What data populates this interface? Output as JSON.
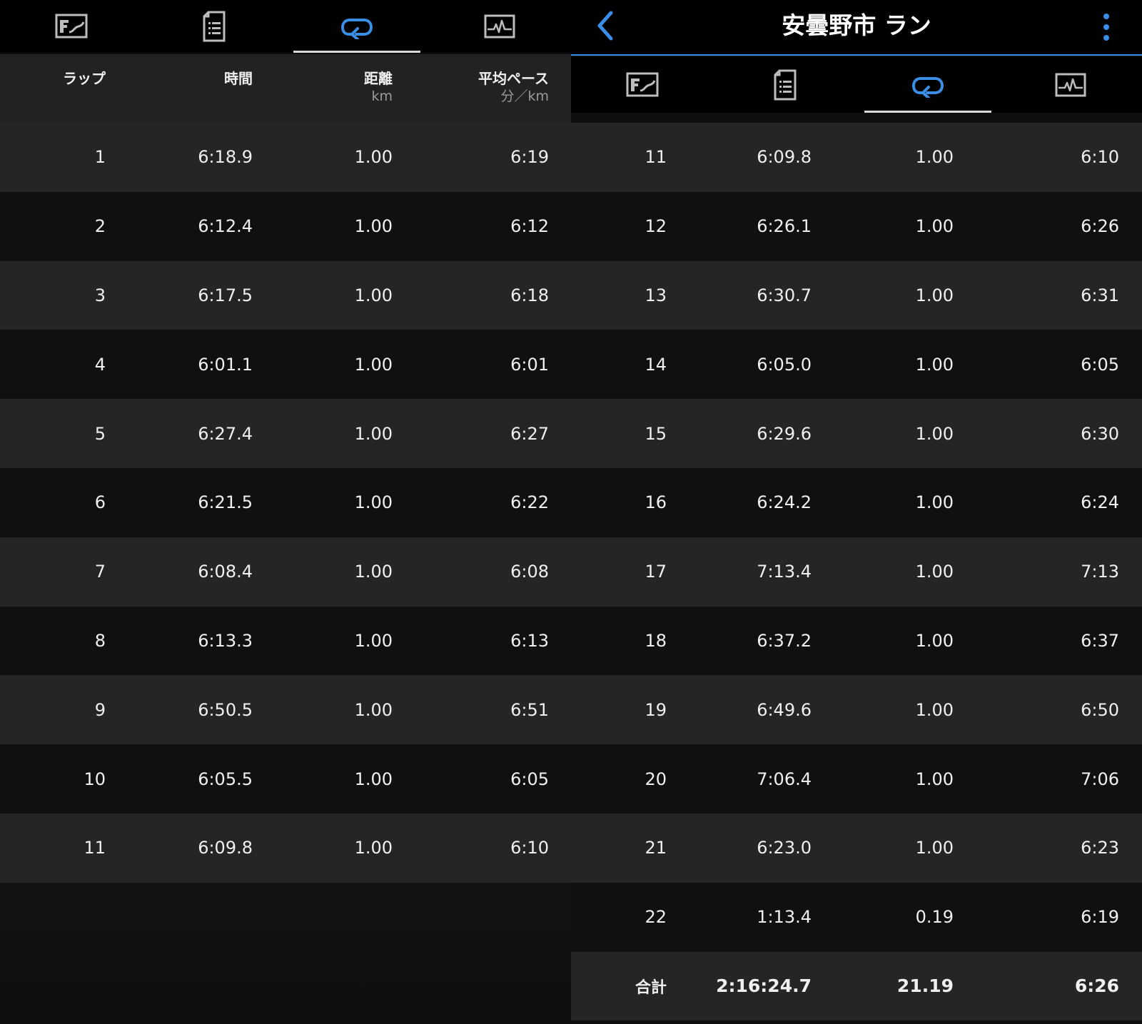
{
  "left_panel": {
    "tabs": [
      {
        "name": "tab-map",
        "icon": "map-icon"
      },
      {
        "name": "tab-details",
        "icon": "document-icon"
      },
      {
        "name": "tab-laps",
        "icon": "laps-loop-icon",
        "active": true
      },
      {
        "name": "tab-charts",
        "icon": "chart-icon"
      }
    ],
    "columns": {
      "lap": {
        "label": "ラップ",
        "unit": ""
      },
      "time": {
        "label": "時間",
        "unit": ""
      },
      "distance": {
        "label": "距離",
        "unit": "km"
      },
      "pace": {
        "label": "平均ペース",
        "unit": "分／km"
      }
    },
    "rows": [
      {
        "lap": "1",
        "time": "6:18.9",
        "distance": "1.00",
        "pace": "6:19"
      },
      {
        "lap": "2",
        "time": "6:12.4",
        "distance": "1.00",
        "pace": "6:12"
      },
      {
        "lap": "3",
        "time": "6:17.5",
        "distance": "1.00",
        "pace": "6:18"
      },
      {
        "lap": "4",
        "time": "6:01.1",
        "distance": "1.00",
        "pace": "6:01"
      },
      {
        "lap": "5",
        "time": "6:27.4",
        "distance": "1.00",
        "pace": "6:27"
      },
      {
        "lap": "6",
        "time": "6:21.5",
        "distance": "1.00",
        "pace": "6:22"
      },
      {
        "lap": "7",
        "time": "6:08.4",
        "distance": "1.00",
        "pace": "6:08"
      },
      {
        "lap": "8",
        "time": "6:13.3",
        "distance": "1.00",
        "pace": "6:13"
      },
      {
        "lap": "9",
        "time": "6:50.5",
        "distance": "1.00",
        "pace": "6:51"
      },
      {
        "lap": "10",
        "time": "6:05.5",
        "distance": "1.00",
        "pace": "6:05"
      },
      {
        "lap": "11",
        "time": "6:09.8",
        "distance": "1.00",
        "pace": "6:10"
      }
    ]
  },
  "right_panel": {
    "title": "安曇野市 ラン",
    "back_icon": "chevron-left-icon",
    "more_icon": "more-vertical-icon",
    "accent": "#3a8ee6",
    "rows": [
      {
        "lap": "11",
        "time": "6:09.8",
        "distance": "1.00",
        "pace": "6:10"
      },
      {
        "lap": "12",
        "time": "6:26.1",
        "distance": "1.00",
        "pace": "6:26"
      },
      {
        "lap": "13",
        "time": "6:30.7",
        "distance": "1.00",
        "pace": "6:31"
      },
      {
        "lap": "14",
        "time": "6:05.0",
        "distance": "1.00",
        "pace": "6:05"
      },
      {
        "lap": "15",
        "time": "6:29.6",
        "distance": "1.00",
        "pace": "6:30"
      },
      {
        "lap": "16",
        "time": "6:24.2",
        "distance": "1.00",
        "pace": "6:24"
      },
      {
        "lap": "17",
        "time": "7:13.4",
        "distance": "1.00",
        "pace": "7:13"
      },
      {
        "lap": "18",
        "time": "6:37.2",
        "distance": "1.00",
        "pace": "6:37"
      },
      {
        "lap": "19",
        "time": "6:49.6",
        "distance": "1.00",
        "pace": "6:50"
      },
      {
        "lap": "20",
        "time": "7:06.4",
        "distance": "1.00",
        "pace": "7:06"
      },
      {
        "lap": "21",
        "time": "6:23.0",
        "distance": "1.00",
        "pace": "6:23"
      },
      {
        "lap": "22",
        "time": "1:13.4",
        "distance": "0.19",
        "pace": "6:19"
      }
    ],
    "total": {
      "lap": "合計",
      "time": "2:16:24.7",
      "distance": "21.19",
      "pace": "6:26"
    }
  }
}
